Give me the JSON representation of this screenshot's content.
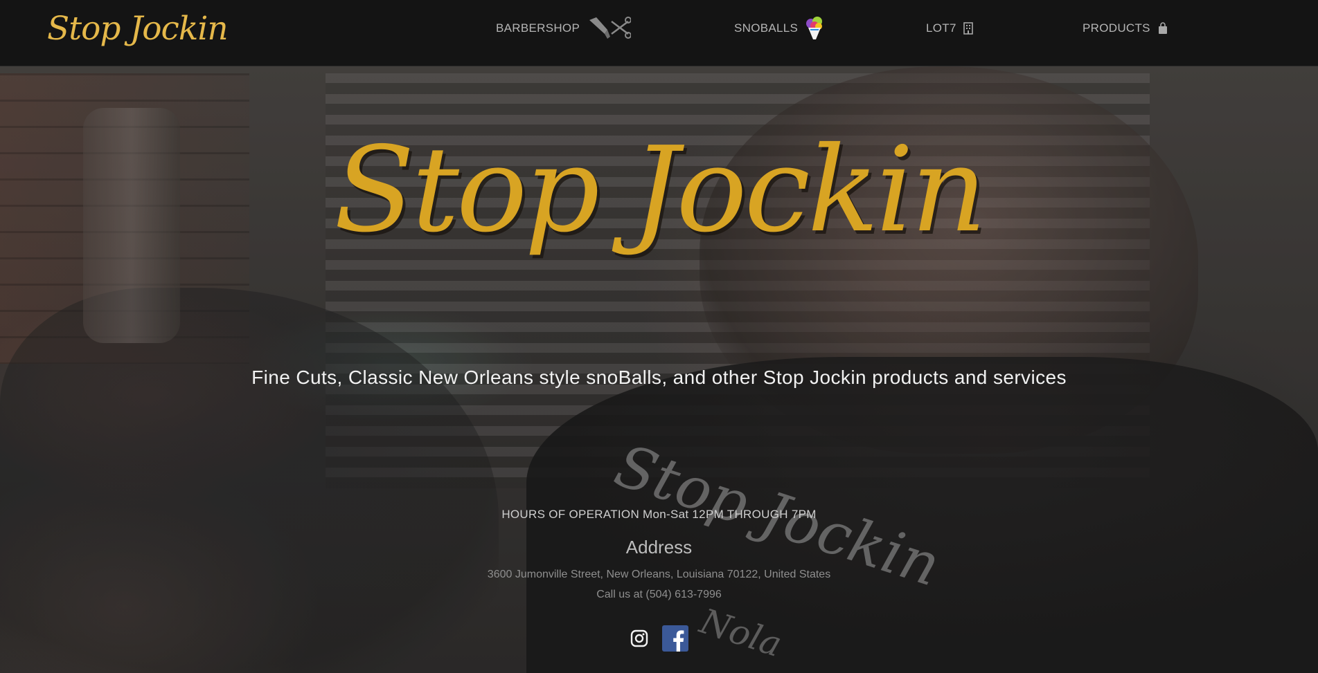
{
  "nav": {
    "brand": "Stop Jockin",
    "items": [
      {
        "label": "BARBERSHOP",
        "icon": "barber-tools-icon"
      },
      {
        "label": "SNOBALLS",
        "icon": "snoball-icon"
      },
      {
        "label": "LOT7",
        "icon": "building-icon"
      },
      {
        "label": "PRODUCTS",
        "icon": "shopping-bag-icon"
      }
    ]
  },
  "hero": {
    "title": "Stop Jockin",
    "tagline": "Fine Cuts, Classic New Orleans style snoBalls, and other Stop Jockin products and services",
    "shirt_print": "Stop Jockin",
    "shirt_print_sub": "Nola"
  },
  "info": {
    "hours": "HOURS OF OPERATION Mon-Sat 12PM THROUGH 7PM",
    "address_heading": "Address",
    "address": "3600 Jumonville Street, New Orleans, Louisiana 70122, United States",
    "phone": "Call us at (504) 613-7996"
  },
  "social": {
    "items": [
      {
        "name": "instagram-icon"
      },
      {
        "name": "facebook-icon"
      }
    ]
  },
  "colors": {
    "brand_gold": "#d8a423",
    "nav_bg": "#141414",
    "nav_text": "#b5b5b5",
    "facebook_blue": "#3b5998"
  }
}
